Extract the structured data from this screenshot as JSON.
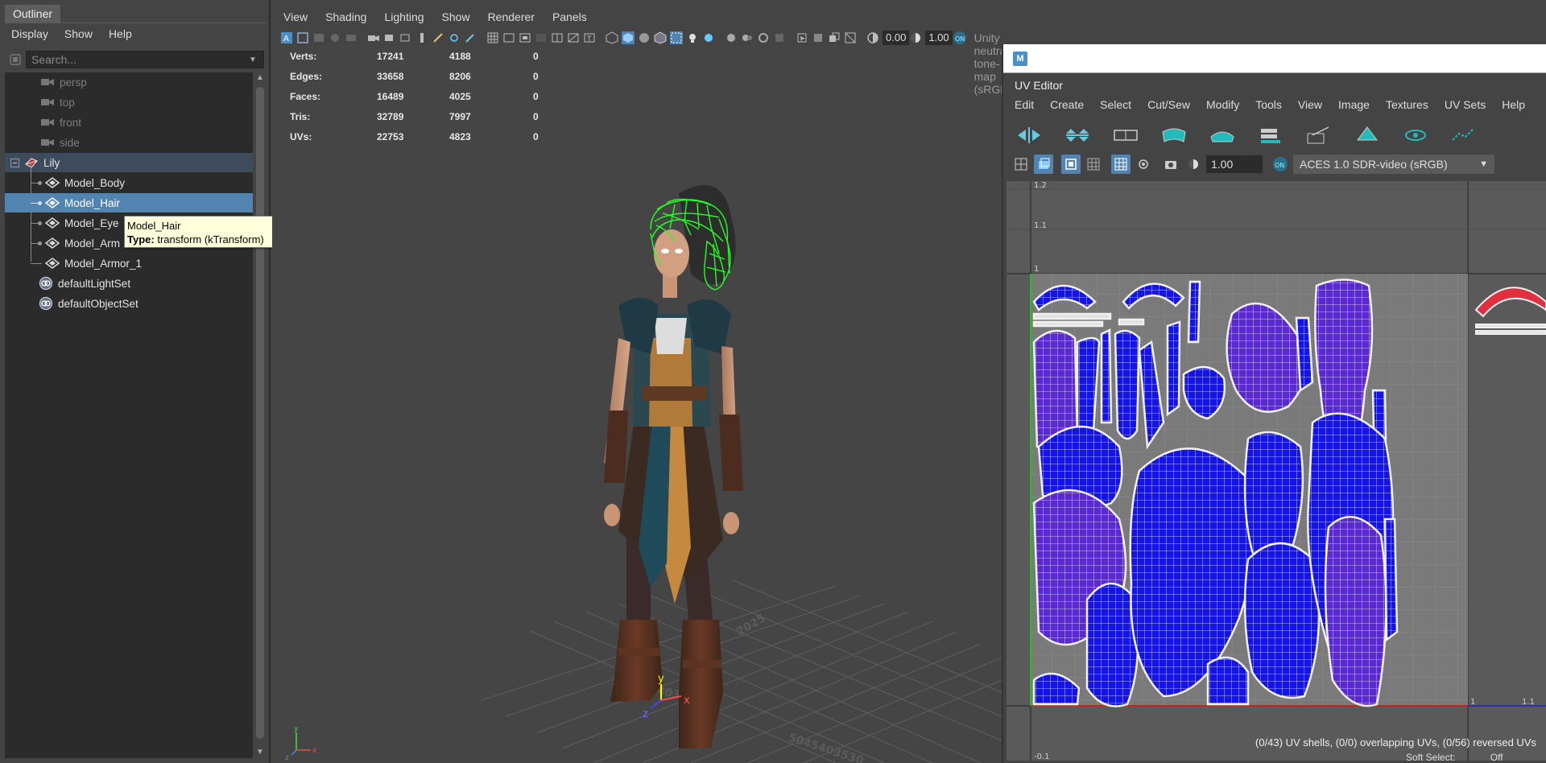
{
  "outliner": {
    "title": "Outliner",
    "menu": [
      "Display",
      "Show",
      "Help"
    ],
    "search_placeholder": "Search...",
    "items": [
      {
        "label": "persp",
        "type": "camera"
      },
      {
        "label": "top",
        "type": "camera"
      },
      {
        "label": "front",
        "type": "camera"
      },
      {
        "label": "side",
        "type": "camera"
      },
      {
        "label": "Lily",
        "type": "group"
      },
      {
        "label": "Model_Body",
        "type": "mesh"
      },
      {
        "label": "Model_Hair",
        "type": "mesh",
        "selected": true
      },
      {
        "label": "Model_Eye",
        "type": "mesh"
      },
      {
        "label": "Model_Arm",
        "type": "mesh"
      },
      {
        "label": "Model_Armor_1",
        "type": "mesh"
      },
      {
        "label": "defaultLightSet",
        "type": "set"
      },
      {
        "label": "defaultObjectSet",
        "type": "set"
      }
    ],
    "tooltip": {
      "name": "Model_Hair",
      "type_label": "Type:",
      "type_value": "transform (kTransform)"
    }
  },
  "viewport": {
    "menu": [
      "View",
      "Shading",
      "Lighting",
      "Show",
      "Renderer",
      "Panels"
    ],
    "exposure": "0.00",
    "gamma": "1.00",
    "colorspace": "Unity neutral tone-map (sRGB)",
    "hud": [
      {
        "label": "Verts:",
        "a": "17241",
        "b": "4188",
        "c": "0"
      },
      {
        "label": "Edges:",
        "a": "33658",
        "b": "8206",
        "c": "0"
      },
      {
        "label": "Faces:",
        "a": "16489",
        "b": "4025",
        "c": "0"
      },
      {
        "label": "Tris:",
        "a": "32789",
        "b": "7997",
        "c": "0"
      },
      {
        "label": "UVs:",
        "a": "22753",
        "b": "4823",
        "c": "0"
      }
    ],
    "axis_labels": {
      "y": "y",
      "x": "x",
      "z": "z"
    }
  },
  "uv_editor": {
    "title": "UV Editor",
    "menu": [
      "Edit",
      "Create",
      "Select",
      "Cut/Sew",
      "Modify",
      "Tools",
      "View",
      "Image",
      "Textures",
      "UV Sets",
      "Help"
    ],
    "gamma": "1.00",
    "colorspace": "ACES 1.0 SDR-video (sRGB)",
    "grid_labels": {
      "v12": "1.2",
      "v11": "1.1",
      "v1": "1",
      "u1": "1",
      "u11": "1.1",
      "vneg": "-0.1"
    },
    "status": "(0/43) UV shells, (0/0) overlapping UVs, (0/56) reversed UVs",
    "soft_select": "Soft Select:",
    "soft_select_value": "Off",
    "colors": {
      "shell_fill": "#1212e6",
      "shell_wire": "#ffffff",
      "uv_bg": "#7a7a7a"
    }
  },
  "colors": {
    "selection": "#5284b1",
    "hair_wire": "#22ff22"
  }
}
